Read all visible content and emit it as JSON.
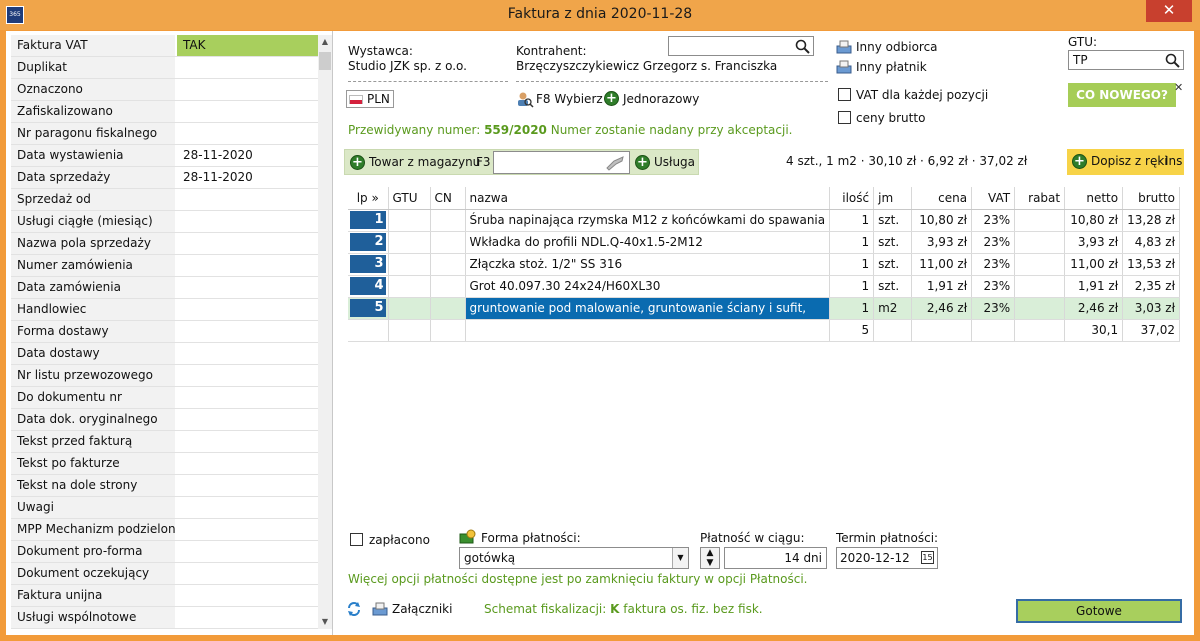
{
  "window": {
    "title": "Faktura z dnia 2020-11-28",
    "app_icon_text": "365",
    "close_symbol": "✕"
  },
  "left_panel": {
    "rows": [
      {
        "label": "Faktura VAT",
        "value": "TAK"
      },
      {
        "label": "Duplikat",
        "value": ""
      },
      {
        "label": "Oznaczono",
        "value": ""
      },
      {
        "label": "Zafiskalizowano",
        "value": ""
      },
      {
        "label": "Nr paragonu fiskalnego",
        "value": ""
      },
      {
        "label": "Data wystawienia",
        "value": "28-11-2020"
      },
      {
        "label": "Data sprzedaży",
        "value": "28-11-2020"
      },
      {
        "label": "Sprzedaż od",
        "value": ""
      },
      {
        "label": "Usługi ciągłe (miesiąc)",
        "value": ""
      },
      {
        "label": "Nazwa pola sprzedaży",
        "value": ""
      },
      {
        "label": "Numer zamówienia",
        "value": ""
      },
      {
        "label": "Data zamówienia",
        "value": ""
      },
      {
        "label": "Handlowiec",
        "value": ""
      },
      {
        "label": "Forma dostawy",
        "value": ""
      },
      {
        "label": "Data dostawy",
        "value": ""
      },
      {
        "label": "Nr listu przewozowego",
        "value": ""
      },
      {
        "label": "Do dokumentu nr",
        "value": ""
      },
      {
        "label": "Data dok. oryginalnego",
        "value": ""
      },
      {
        "label": "Tekst przed fakturą",
        "value": ""
      },
      {
        "label": "Tekst po fakturze",
        "value": ""
      },
      {
        "label": "Tekst na dole strony",
        "value": ""
      },
      {
        "label": "Uwagi",
        "value": ""
      },
      {
        "label": "MPP Mechanizm podzielon...",
        "value": ""
      },
      {
        "label": "Dokument pro-forma",
        "value": ""
      },
      {
        "label": "Dokument oczekujący",
        "value": ""
      },
      {
        "label": "Faktura unijna",
        "value": ""
      },
      {
        "label": "Usługi wspólnotowe",
        "value": ""
      }
    ]
  },
  "header": {
    "issuer_label": "Wystawca:",
    "issuer_name": "Studio JZK sp. z o.o.",
    "contractor_label": "Kontrahent:",
    "contractor_name": "Brzęczyszczykiewicz Grzegorz s. Franciszka",
    "currency": "PLN",
    "f8_label": "F8 Wybierz",
    "one_time_label": "Jednorazowy",
    "other_recipient": "Inny odbiorca",
    "other_payer": "Inny płatnik",
    "vat_each_position": "VAT dla każdej pozycji",
    "gross_prices": "ceny brutto",
    "gtu_label": "GTU:",
    "gtu_value": "TP",
    "whats_new": "CO NOWEGO?",
    "predicted_prefix": "Przewidywany numer: ",
    "predicted_number": "559/2020",
    "predicted_suffix": " Numer zostanie nadany przy akceptacji."
  },
  "toolbar": {
    "warehouse_label": "Towar z magazynu",
    "warehouse_shortcut": "F3",
    "service_label": "Usługa",
    "summary": "4 szt., 1 m2 · 30,10 zł · 6,92 zł · 37,02 zł",
    "handwrite_label": "Dopisz z ręki",
    "handwrite_shortcut": "Ins"
  },
  "table": {
    "headers": [
      "lp »",
      "GTU",
      "CN",
      "nazwa",
      "ilość",
      "jm",
      "cena",
      "VAT",
      "rabat",
      "netto",
      "brutto"
    ],
    "rows": [
      {
        "lp": "1",
        "gtu": "",
        "cn": "",
        "name": "Śruba napinająca rzymska M12 z końcówkami do spawania",
        "qty": "1",
        "unit": "szt.",
        "price": "10,80 zł",
        "vat": "23%",
        "discount": "",
        "net": "10,80 zł",
        "gross": "13,28 zł"
      },
      {
        "lp": "2",
        "gtu": "",
        "cn": "",
        "name": "Wkładka do profili NDL.Q-40x1.5-2M12",
        "qty": "1",
        "unit": "szt.",
        "price": "3,93 zł",
        "vat": "23%",
        "discount": "",
        "net": "3,93 zł",
        "gross": "4,83 zł"
      },
      {
        "lp": "3",
        "gtu": "",
        "cn": "",
        "name": "Złączka stoż. 1/2\" SS 316",
        "qty": "1",
        "unit": "szt.",
        "price": "11,00 zł",
        "vat": "23%",
        "discount": "",
        "net": "11,00 zł",
        "gross": "13,53 zł"
      },
      {
        "lp": "4",
        "gtu": "",
        "cn": "",
        "name": "Grot 40.097.30  24x24/H60XL30",
        "qty": "1",
        "unit": "szt.",
        "price": "1,91 zł",
        "vat": "23%",
        "discount": "",
        "net": "1,91 zł",
        "gross": "2,35 zł"
      },
      {
        "lp": "5",
        "gtu": "",
        "cn": "",
        "name": "gruntowanie pod malowanie, gruntowanie ściany i sufit,",
        "qty": "1",
        "unit": "m2",
        "price": "2,46 zł",
        "vat": "23%",
        "discount": "",
        "net": "2,46 zł",
        "gross": "3,03 zł"
      }
    ],
    "totals": {
      "qty": "5",
      "net": "30,1",
      "gross": "37,02"
    }
  },
  "payment": {
    "paid_label": "zapłacono",
    "method_label": "Forma płatności:",
    "method_value": "gotówką",
    "within_label": "Płatność w ciągu:",
    "within_value": "14 dni",
    "deadline_label": "Termin płatności:",
    "deadline_value": "2020-12-12",
    "more_options": "Więcej opcji płatności dostępne jest po zamknięciu faktury w opcji Płatności."
  },
  "footer": {
    "attachments_label": "Załączniki",
    "fiscal_prefix": "Schemat fiskalizacji: ",
    "fiscal_code": "K",
    "fiscal_suffix": " faktura os. fiz. bez fisk.",
    "done_label": "Gotowe"
  },
  "colors": {
    "titlebar": "#f0a54a",
    "accent_green": "#a8cf5d",
    "selection_blue": "#0a6bb0",
    "lp_blue": "#1f5f9a",
    "text_green": "#5a9a1e",
    "handwrite_yellow": "#f7d348"
  }
}
